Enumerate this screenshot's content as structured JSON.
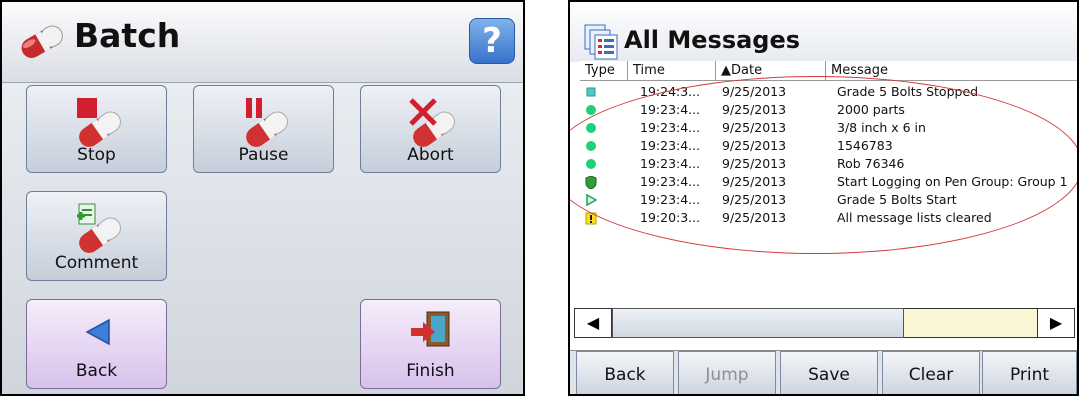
{
  "batch": {
    "title": "Batch",
    "help_label": "?",
    "buttons": {
      "stop": "Stop",
      "pause": "Pause",
      "abort": "Abort",
      "comment": "Comment",
      "back": "Back",
      "finish": "Finish"
    }
  },
  "messages": {
    "title": "All Messages",
    "columns": {
      "type": "Type",
      "time": "Time",
      "date": "▲Date",
      "message": "Message"
    },
    "rows": [
      {
        "icon": "teal-square-icon",
        "time": "19:24:3...",
        "date": "9/25/2013",
        "message": "Grade 5 Bolts Stopped"
      },
      {
        "icon": "green-dot-icon",
        "time": "19:23:4...",
        "date": "9/25/2013",
        "message": "2000 parts"
      },
      {
        "icon": "green-dot-icon",
        "time": "19:23:4...",
        "date": "9/25/2013",
        "message": "3/8 inch x 6 in"
      },
      {
        "icon": "green-dot-icon",
        "time": "19:23:4...",
        "date": "9/25/2013",
        "message": "1546783"
      },
      {
        "icon": "green-dot-icon",
        "time": "19:23:4...",
        "date": "9/25/2013",
        "message": "Rob 76346"
      },
      {
        "icon": "green-shield-icon",
        "time": "19:23:4...",
        "date": "9/25/2013",
        "message": "Start Logging on Pen Group: Group 1"
      },
      {
        "icon": "green-play-icon",
        "time": "19:23:4...",
        "date": "9/25/2013",
        "message": "Grade 5 Bolts Start"
      },
      {
        "icon": "warning-icon",
        "time": "19:20:3...",
        "date": "9/25/2013",
        "message": "All message lists cleared"
      }
    ],
    "scroll_left": "◀",
    "scroll_right": "▶",
    "bottom_buttons": {
      "back": "Back",
      "jump": "Jump",
      "save": "Save",
      "clear": "Clear",
      "print": "Print"
    },
    "colors": {
      "highlight": "#d63a3a",
      "scroll_track": "#fbf6d3"
    }
  }
}
